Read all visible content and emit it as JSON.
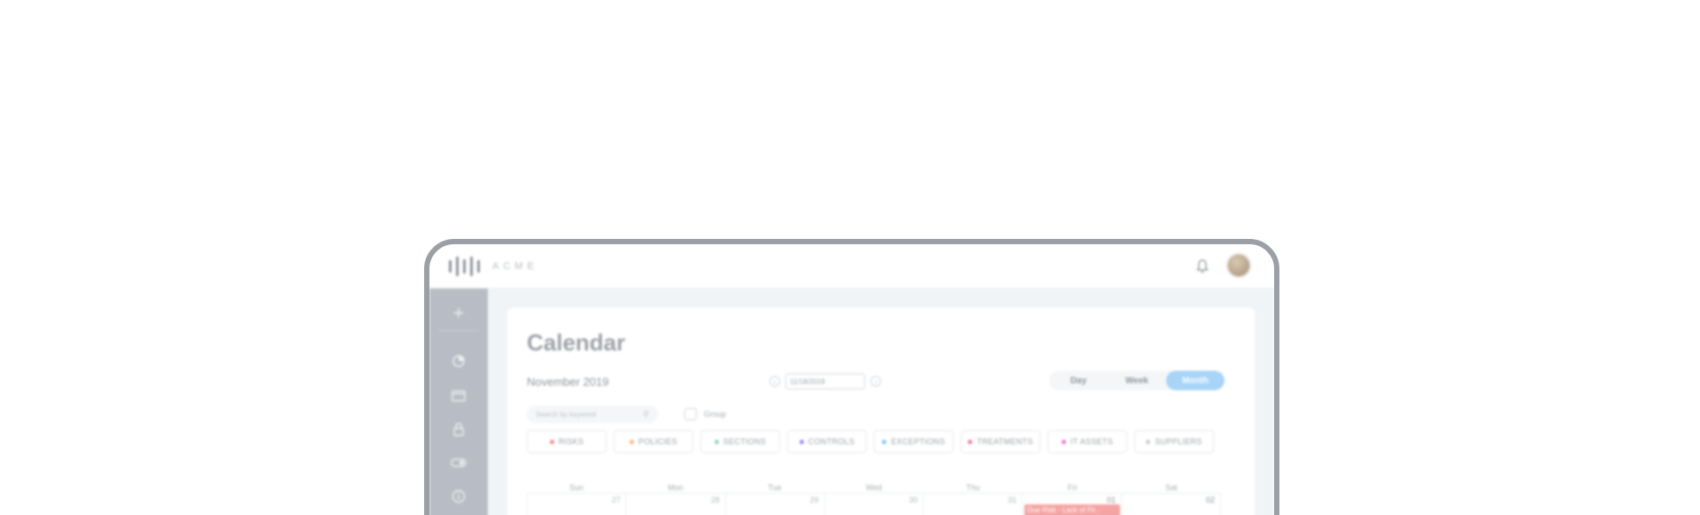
{
  "app": {
    "logo_text": "ACME"
  },
  "page": {
    "title": "Calendar",
    "month_label": "November 2019",
    "date_value": "11/18/2019"
  },
  "views": {
    "day": "Day",
    "week": "Week",
    "month": "Month",
    "active": "Month"
  },
  "search": {
    "placeholder": "Search by keyword"
  },
  "group": {
    "label": "Group"
  },
  "filters": [
    {
      "label": "RISKS",
      "color": "#f28b8b"
    },
    {
      "label": "POLICIES",
      "color": "#f5b97a"
    },
    {
      "label": "SECTIONS",
      "color": "#8fd3c1"
    },
    {
      "label": "CONTROLS",
      "color": "#9b8cf0"
    },
    {
      "label": "EXCEPTIONS",
      "color": "#7ec8ee"
    },
    {
      "label": "TREATMENTS",
      "color": "#f07aa0"
    },
    {
      "label": "IT ASSETS",
      "color": "#e67ad6"
    },
    {
      "label": "SUPPLIERS",
      "color": "#c7cbd0"
    }
  ],
  "calendar": {
    "weekdays": [
      "Sun",
      "Mon",
      "Tue",
      "Wed",
      "Thu",
      "Fri",
      "Sat"
    ],
    "first_row": [
      "27",
      "28",
      "29",
      "30",
      "31",
      "01",
      "02"
    ],
    "event": {
      "day": "01",
      "label": "Due Risk - Lack of Fir..."
    }
  },
  "icons": {
    "plus": "plus-icon",
    "dashboard": "pie-chart-icon",
    "calendar": "calendar-icon",
    "lock": "lock-icon",
    "toggle": "toggle-icon",
    "info": "info-icon",
    "bell": "bell-icon",
    "search": "search-icon"
  },
  "colors": {
    "sidebar": "#b8bdc5",
    "active_view": "#a8d4f7",
    "event": "#f5a3a3",
    "background": "#f1f4f7"
  }
}
